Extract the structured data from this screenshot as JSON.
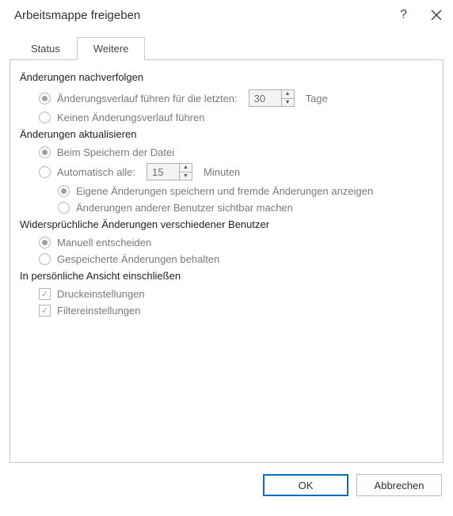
{
  "title": "Arbeitsmappe freigeben",
  "tabs": {
    "status": "Status",
    "weitere": "Weitere"
  },
  "track": {
    "header": "Änderungen nachverfolgen",
    "keep_history_label_pre": "Änderungsverlauf führen für die letzten:",
    "keep_history_days_value": "30",
    "keep_history_label_post": "Tage",
    "no_history_label": "Keinen Änderungsverlauf führen"
  },
  "update": {
    "header": "Änderungen aktualisieren",
    "on_save_label": "Beim Speichern der Datei",
    "auto_every_label": "Automatisch alle:",
    "auto_every_value": "15",
    "auto_every_unit": "Minuten",
    "auto_opt1": "Eigene Änderungen speichern und fremde Änderungen anzeigen",
    "auto_opt2": "Änderungen anderer Benutzer sichtbar machen"
  },
  "conflict": {
    "header": "Widersprüchliche Änderungen verschiedener Benutzer",
    "manual_label": "Manuell entscheiden",
    "keep_saved_label": "Gespeicherte Änderungen behalten"
  },
  "personal": {
    "header": "In persönliche Ansicht einschließen",
    "print_label": "Druckeinstellungen",
    "filter_label": "Filtereinstellungen"
  },
  "buttons": {
    "ok": "OK",
    "cancel": "Abbrechen"
  }
}
